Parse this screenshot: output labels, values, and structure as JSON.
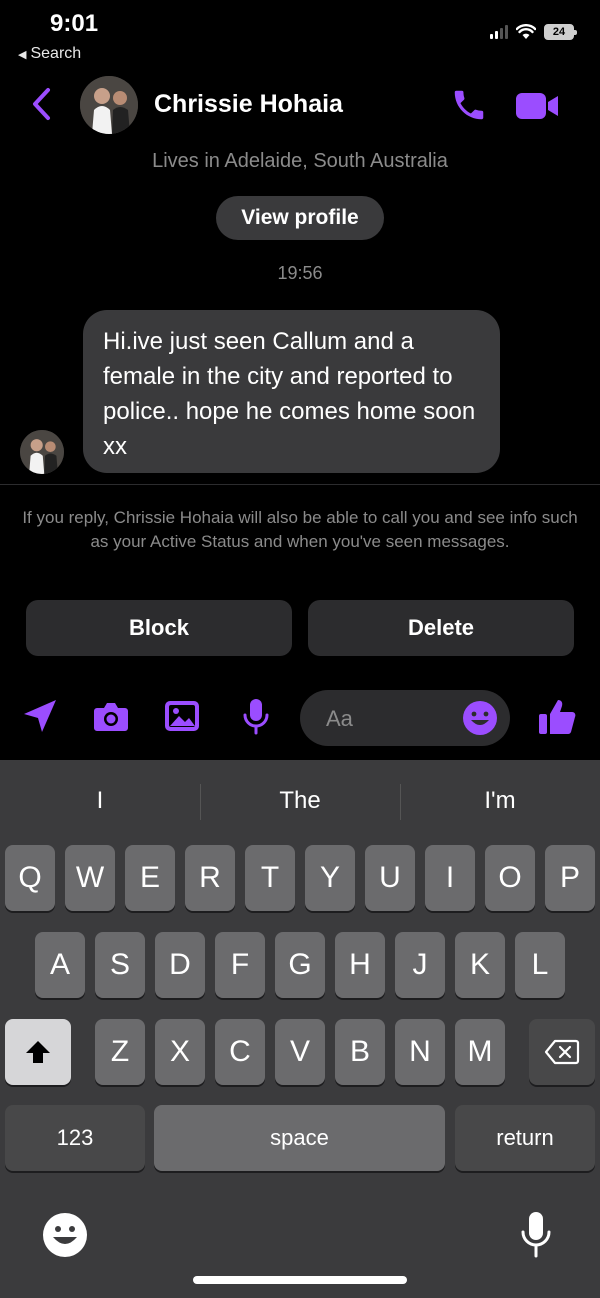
{
  "status_bar": {
    "time": "9:01",
    "back_label": "Search",
    "battery": "24"
  },
  "header": {
    "contact_name": "Chrissie Hohaia",
    "back_icon": "chevron-left-icon",
    "call_icon": "phone-icon",
    "video_icon": "video-camera-icon",
    "accent_color": "#9b4dff"
  },
  "profile": {
    "lives_in": "Lives in Adelaide, South Australia",
    "view_profile_label": "View profile"
  },
  "conversation": {
    "timestamp": "19:56",
    "message": "Hi.ive just seen Callum and a female in the city and reported to police.. hope he comes home soon xx"
  },
  "request": {
    "note": "If you reply, Chrissie Hohaia will also be able to call you and see info such as your Active Status and when you've seen messages.",
    "block_label": "Block",
    "delete_label": "Delete"
  },
  "composer": {
    "placeholder": "Aa",
    "icons": [
      "location-arrow-icon",
      "camera-icon",
      "gallery-icon",
      "microphone-icon",
      "emoji-icon",
      "thumbs-up-icon"
    ]
  },
  "keyboard": {
    "suggestions": [
      "I",
      "The",
      "I'm"
    ],
    "row1": [
      "Q",
      "W",
      "E",
      "R",
      "T",
      "Y",
      "U",
      "I",
      "O",
      "P"
    ],
    "row2": [
      "A",
      "S",
      "D",
      "F",
      "G",
      "H",
      "J",
      "K",
      "L"
    ],
    "row3": [
      "Z",
      "X",
      "C",
      "V",
      "B",
      "N",
      "M"
    ],
    "numbers_label": "123",
    "space_label": "space",
    "return_label": "return"
  }
}
